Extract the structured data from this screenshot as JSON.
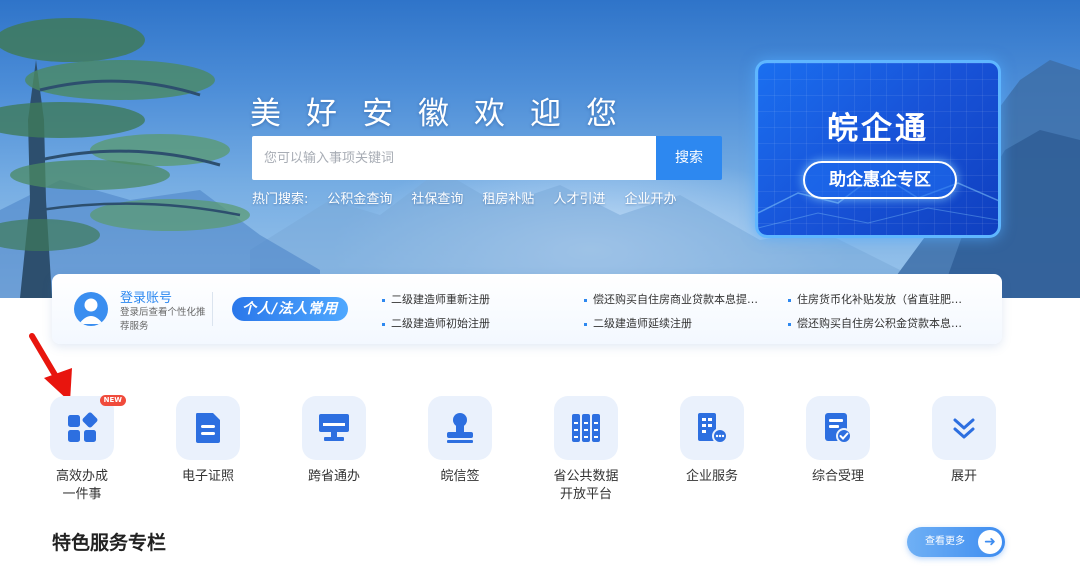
{
  "hero": {
    "title": "美好安徽欢迎您",
    "search_placeholder": "您可以输入事项关键词",
    "search_button": "搜索",
    "hot_label": "热门搜索:",
    "hot_items": [
      "公积金查询",
      "社保查询",
      "租房补贴",
      "人才引进",
      "企业开办"
    ]
  },
  "promo": {
    "title": "皖企通",
    "button": "助企惠企专区"
  },
  "login": {
    "title": "登录账号",
    "subtitle": "登录后查看个性化推荐服务",
    "badge": "个人/法人常用"
  },
  "quick_links": [
    "二级建造师重新注册",
    "偿还购买自住房商业贷款本息提…",
    "住房货币化补贴发放（省直驻肥…",
    "二级建造师初始注册",
    "二级建造师延续注册",
    "偿还购买自住房公积金贷款本息…"
  ],
  "services": [
    {
      "label": "高效办成一件事",
      "line1": "高效办成",
      "line2": "一件事",
      "icon": "grid-apps-icon",
      "tag": "NEW"
    },
    {
      "label": "电子证照",
      "icon": "document-icon"
    },
    {
      "label": "跨省通办",
      "icon": "monitor-icon"
    },
    {
      "label": "皖信签",
      "icon": "stamp-icon"
    },
    {
      "label": "省公共数据开放平台",
      "line1": "省公共数据",
      "line2": "开放平台",
      "icon": "database-icon"
    },
    {
      "label": "企业服务",
      "icon": "building-icon"
    },
    {
      "label": "综合受理",
      "icon": "checklist-icon"
    },
    {
      "label": "展开",
      "icon": "chevron-double-down-icon"
    }
  ],
  "section": {
    "title": "特色服务专栏",
    "more": "查看更多"
  },
  "colors": {
    "primary": "#2d88f0",
    "icon_bg": "#eaf1fc",
    "new_tag": "#f04b3c",
    "arrow": "#e8150e"
  }
}
